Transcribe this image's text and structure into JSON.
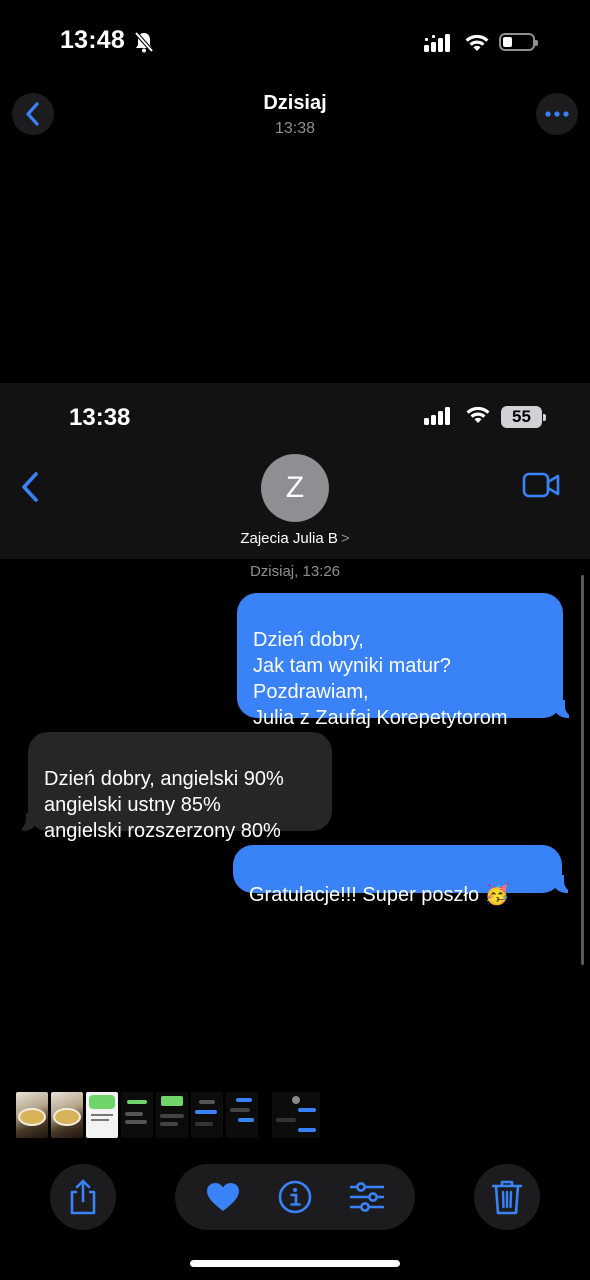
{
  "status_bar": {
    "time": "13:48"
  },
  "photo_header": {
    "title": "Dzisiaj",
    "subtitle": "13:38"
  },
  "screenshot": {
    "status_bar": {
      "time": "13:38",
      "battery": "55"
    },
    "contact": {
      "avatar_initial": "Z",
      "name": "Zajecia Julia B",
      "chevron": ">"
    },
    "date_separator": "Dzisiaj, 13:26",
    "messages": [
      {
        "direction": "outgoing",
        "text": "Dzień dobry,\nJak tam wyniki matur?\nPozdrawiam,\nJulia z Zaufaj Korepetytorom"
      },
      {
        "direction": "incoming",
        "text": "Dzień dobry, angielski 90%\nangielski ustny 85%\nangielski rozszerzony 80%"
      },
      {
        "direction": "outgoing",
        "text": "Gratulacje!!! Super poszło 🥳"
      }
    ]
  },
  "icons": {
    "back": "chevron-left-icon",
    "more": "ellipsis-icon",
    "video": "video-camera-icon",
    "share": "share-icon",
    "favorite": "heart-icon",
    "info": "info-icon",
    "adjust": "sliders-icon",
    "delete": "trash-icon"
  },
  "colors": {
    "accent": "#3a82f7",
    "outgoing_bubble": "#3a82f7",
    "incoming_bubble": "#262628",
    "background": "#000000",
    "toolbar": "#1c1c1e"
  }
}
